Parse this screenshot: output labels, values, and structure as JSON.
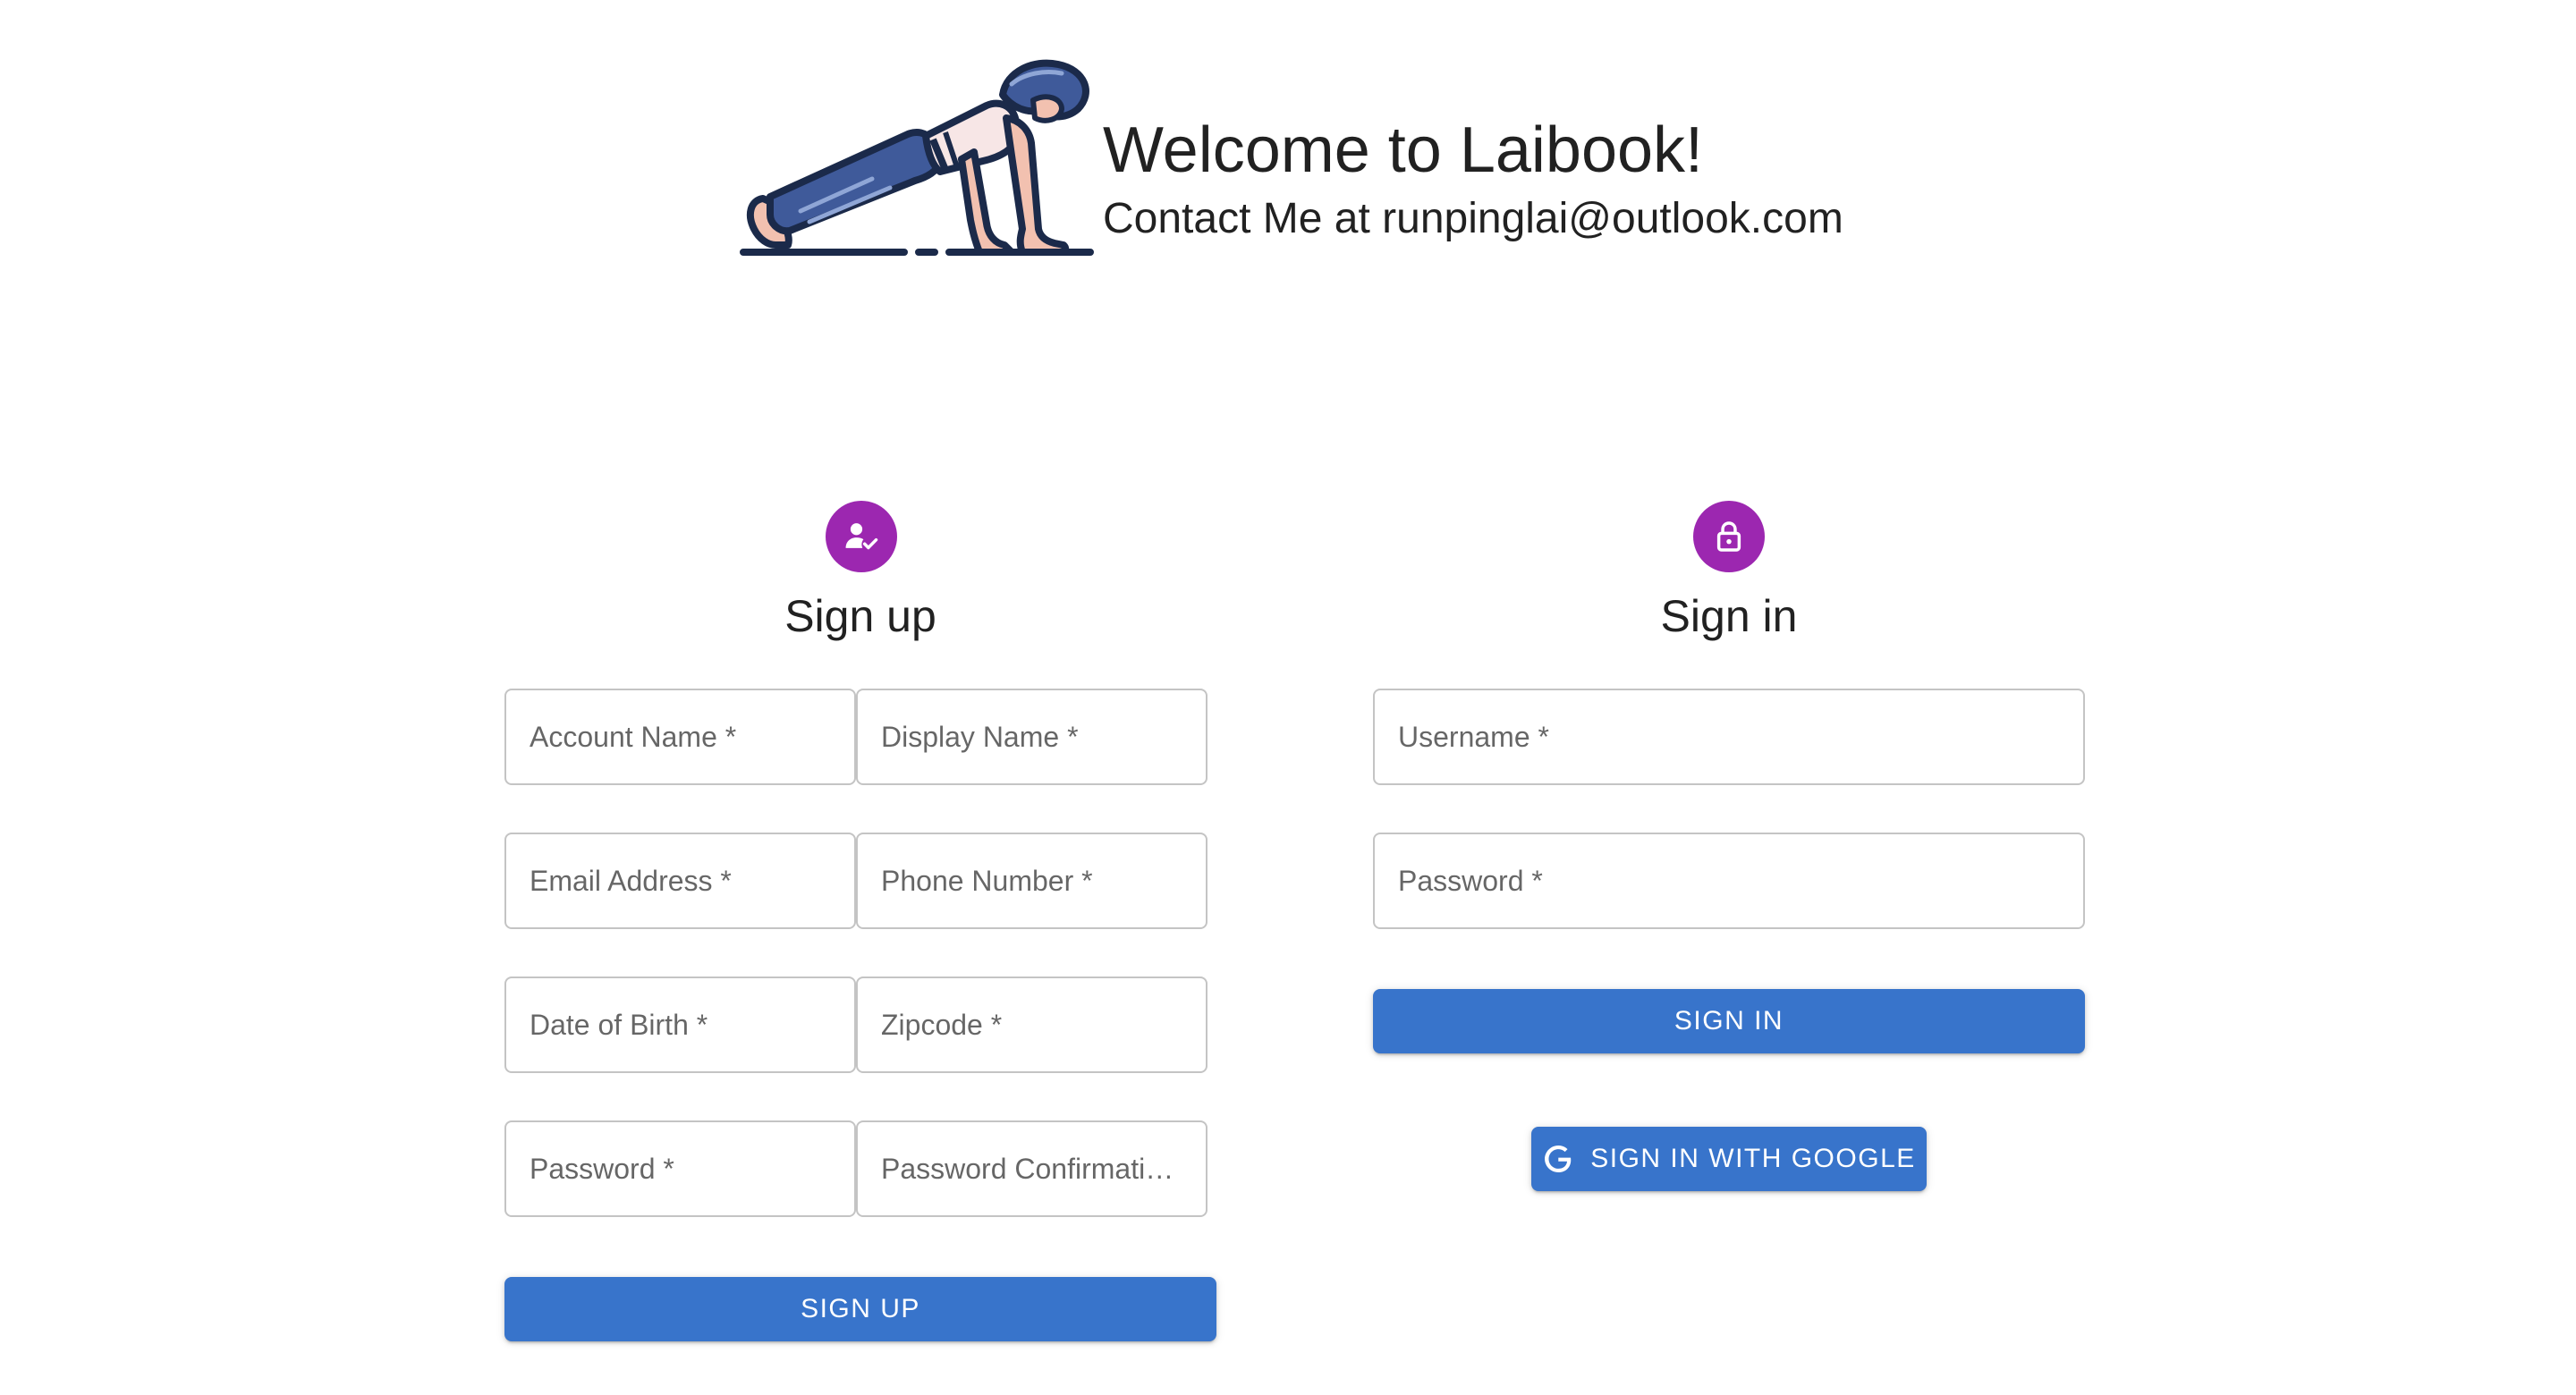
{
  "header": {
    "title": "Welcome to Laibook!",
    "contact": "Contact Me at runpinglai@outlook.com"
  },
  "signup": {
    "icon": "person-check-icon",
    "title": "Sign up",
    "fields": {
      "account_name": "Account Name *",
      "display_name": "Display Name *",
      "email": "Email Address *",
      "phone": "Phone Number *",
      "dob": "Date of Birth *",
      "zipcode": "Zipcode *",
      "password": "Password *",
      "password_confirmation": "Password Confirmation *"
    },
    "button_label": "SIGN UP"
  },
  "signin": {
    "icon": "lock-icon",
    "title": "Sign in",
    "fields": {
      "username": "Username *",
      "password": "Password *"
    },
    "button_label": "SIGN IN",
    "google_button_label": "SIGN IN WITH GOOGLE",
    "google_icon": "google-g-icon"
  },
  "colors": {
    "primary": "#3874cb",
    "avatar": "#9c27b0",
    "field_border": "#c4c4c4",
    "logo_navy": "#1b2a4a",
    "logo_pants": "#3f5a9a",
    "logo_skin": "#f2c1b0",
    "logo_top": "#f7e6e6"
  }
}
